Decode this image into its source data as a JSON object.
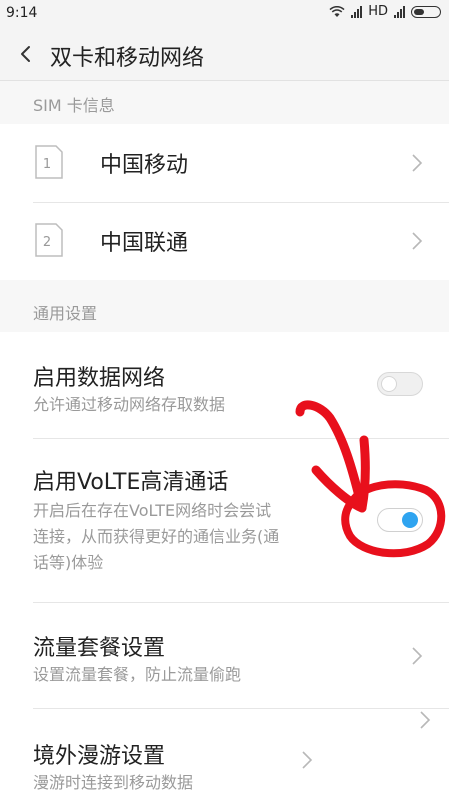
{
  "status_bar": {
    "time": "9:14",
    "network": "HD"
  },
  "header": {
    "title": "双卡和移动网络"
  },
  "sim_section": {
    "header": "SIM 卡信息",
    "cards": [
      {
        "slot": "1",
        "name": "中国移动"
      },
      {
        "slot": "2",
        "name": "中国联通"
      }
    ]
  },
  "general_section": {
    "header": "通用设置",
    "items": [
      {
        "title": "启用数据网络",
        "desc_lines": [
          "允许通过移动网络存取数据"
        ],
        "toggle": "off"
      },
      {
        "title": "启用VoLTE高清通话",
        "desc_lines": [
          "开启后在存在VoLTE网络时会尝试",
          "连接，从而获得更好的通信业务(通",
          "话等)体验"
        ],
        "toggle": "on"
      },
      {
        "title": "流量套餐设置",
        "desc_lines": [
          "设置流量套餐，防止流量偷跑"
        ]
      },
      {
        "title": "境外漫游设置",
        "desc_lines": [
          "漫游时连接到移动数据"
        ]
      }
    ]
  },
  "colors": {
    "toggle_on_accent": "#2fa4f0",
    "annotation_red": "#e8101c"
  },
  "icons": {
    "back": "chevron-left-icon",
    "row_arrow": "chevron-right-icon",
    "wifi": "wifi-icon",
    "signal": "signal-icon",
    "battery": "battery-icon"
  }
}
